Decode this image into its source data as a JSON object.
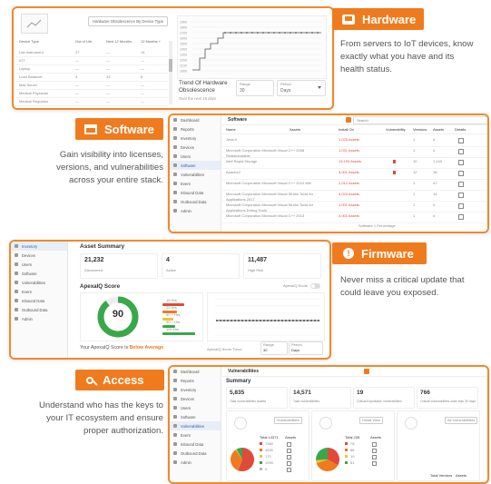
{
  "colors": {
    "accent": "#ef7b1e",
    "green": "#3aa84a",
    "red": "#e04a3a",
    "yellow": "#f2c230",
    "grey": "#bbbbbb"
  },
  "hardware": {
    "tag": "Hardware",
    "icon": "monitor-icon",
    "desc": [
      "From servers to IoT devices, know",
      "exactly what you have and its",
      "health status."
    ],
    "dropdown": "Hardware Obsolescence By Device Type",
    "columns": [
      "Device Type",
      "Out of Life",
      "Next 12 Months",
      "12 Months +"
    ],
    "rows": [
      [
        "Lab Instrument",
        "27",
        "—",
        "14"
      ],
      [
        "IOT",
        "—",
        "—",
        "—"
      ],
      [
        "Laptop",
        "—",
        "—",
        "—"
      ],
      [
        "Load Balancer",
        "4",
        "43",
        "8"
      ],
      [
        "Mail Server",
        "—",
        "—",
        "—"
      ],
      [
        "Medical Physician",
        "—",
        "—",
        "—"
      ],
      [
        "Medical Regulator",
        "—",
        "—",
        "—"
      ]
    ],
    "chart_title": "Trend Of Hardware Obsolescence",
    "chart_sub": "Over the next 18 days",
    "range_label": "Range",
    "range_value": "30",
    "period_label": "Period",
    "period_value": "Days",
    "y_ticks": [
      "1900",
      "1800",
      "1700",
      "1600",
      "1500",
      "1400",
      "1300",
      "1200",
      "1100",
      "1000"
    ]
  },
  "software": {
    "tag": "Software",
    "icon": "window-icon",
    "desc": [
      "Gain visibility into licenses,",
      "versions, and vulnerabilities",
      "across your entire stack."
    ],
    "nav": [
      "Dashboard",
      "Reports",
      "Inventory",
      "Devices",
      "Users",
      "Software",
      "Vulnerabilities",
      "Event",
      "Inbound Data",
      "Outbound Data",
      "Admin"
    ],
    "header": "Software",
    "search": "Search",
    "columns": [
      "Name",
      "Assets",
      "Install On",
      "Vulnerability",
      "Versions",
      "Assets",
      "Details"
    ],
    "rows": [
      [
        "Java 8",
        "",
        "1,025 Assets",
        "",
        "1",
        "4",
        ""
      ],
      [
        "Microsoft Corporation Microsoft Visual C++ 2008 Redistributable",
        "",
        "1,031 Assets",
        "",
        "1",
        "4",
        ""
      ],
      [
        "Intel Rapid Storage",
        "",
        "13,193 Assets",
        "",
        "10",
        "1,143",
        ""
      ],
      [
        "Apache2",
        "",
        "3,001 Assets",
        "",
        "12",
        "18",
        ""
      ],
      [
        "Microsoft Corporation Microsoft Visual C++ 2010 x86",
        "",
        "2,012 Assets",
        "",
        "1",
        "47",
        ""
      ],
      [
        "Microsoft Corporation Microsoft Visual Studio Tools for Applications 2017",
        "",
        "4,024 Assets",
        "",
        "1",
        "14",
        ""
      ],
      [
        "Microsoft Corporation Microsoft Visual Studio Tools for Applications Debug Tools",
        "",
        "1,001 Assets",
        "",
        "1",
        "4",
        ""
      ],
      [
        "Microsoft Corporation Microsoft Visual C++ 2013",
        "",
        "3,001 Assets",
        "",
        "1",
        "4",
        ""
      ]
    ],
    "footer": "Software 1 Percentage"
  },
  "firmware": {
    "tag": "Firmware",
    "icon": "alert-icon",
    "desc": [
      "Never miss a critical update that",
      "could leave you exposed."
    ],
    "nav": [
      "Inventory",
      "Devices",
      "Users",
      "Software",
      "Vulnerabilities",
      "Event",
      "Inbound Data",
      "Outbound Data",
      "Admin"
    ],
    "summary_title": "Asset Summary",
    "summary": [
      {
        "value": "21,232",
        "label": "Discovered"
      },
      {
        "value": "4",
        "label": "Active"
      },
      {
        "value": "11,487",
        "label": "High Risk"
      }
    ],
    "score_title": "ApexaIQ Score",
    "score_value": "90",
    "score_toggle": "ApexaIQ Score",
    "legend": [
      {
        "label": "10 Hrs",
        "value": 0.6
      },
      {
        "label": "20 Hrs",
        "value": 0.4
      },
      {
        "label": "60 + Hrs",
        "value": 0.3
      },
      {
        "label": "90 + Hrs",
        "value": 0.35
      },
      {
        "label": "100 Hrs",
        "value": 0.9
      }
    ],
    "footer_prefix": "Your ApexaIQ Score is ",
    "footer_status": "Below Average",
    "trend_label": "ApexaIQ Score Trend",
    "range_label": "Range",
    "range_value": "30",
    "period_label": "Period",
    "period_value": "Days"
  },
  "access": {
    "tag": "Access",
    "icon": "key-icon",
    "desc": [
      "Understand who has the keys to",
      "your IT ecosystem and ensure",
      "proper authorization."
    ],
    "nav": [
      "Dashboard",
      "Reports",
      "Inventory",
      "Devices",
      "Users",
      "Software",
      "Vulnerabilities",
      "Event",
      "Inbound Data",
      "Outbound Data",
      "Admin"
    ],
    "header": "Vulnerabilities",
    "summary_title": "Summary",
    "kpis": [
      {
        "value": "5,835",
        "label": "Total Vulnerabilities Assets"
      },
      {
        "value": "14,571",
        "label": "Total Vulnerabilities"
      },
      {
        "value": "19",
        "label": "Critical Exploitable Vulnerabilities"
      },
      {
        "value": "766",
        "label": "Critical Vulnerabilities older than 30 days"
      }
    ],
    "cards": [
      {
        "button": "Vulnerabilities",
        "total": "Total 14371",
        "col2": "Assets",
        "items": [
          {
            "label": "7380",
            "color": "#e04a3a"
          },
          {
            "label": "4530",
            "color": "#ef7b1e"
          },
          {
            "label": "170",
            "color": "#f2c230"
          },
          {
            "label": "1090",
            "color": "#3aa84a"
          },
          {
            "label": "0",
            "color": "#bbbbbb"
          }
        ]
      },
      {
        "button": "Detail View",
        "total": "Total 235",
        "col2": "Assets",
        "items": [
          {
            "label": "78",
            "color": "#e04a3a"
          },
          {
            "label": "86",
            "color": "#ef7b1e"
          },
          {
            "label": "10",
            "color": "#f2c230"
          },
          {
            "label": "61",
            "color": "#3aa84a"
          }
        ]
      },
      {
        "button": "All Vulnerabilities",
        "total": "Total Vendors",
        "col2": "Assets",
        "items": []
      }
    ]
  }
}
